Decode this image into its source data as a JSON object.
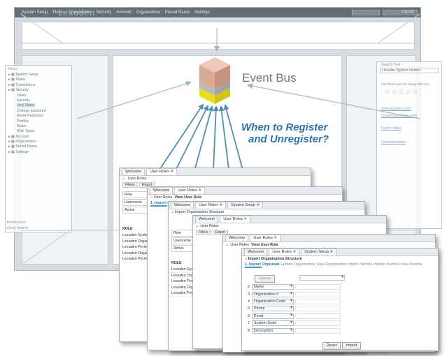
{
  "app": {
    "logo": "Lexaden",
    "menu": [
      "System Setup",
      "Flows",
      "Translations",
      "Security",
      "Account",
      "Organisation",
      "Period Name",
      "Settings"
    ],
    "logout": "Log out"
  },
  "nav": {
    "title": "Menu",
    "items": [
      {
        "label": "System Setup",
        "level": 0
      },
      {
        "label": "Flows",
        "level": 0
      },
      {
        "label": "Translations",
        "level": 0
      },
      {
        "label": "Security",
        "level": 0
      },
      {
        "label": "Users",
        "level": 1
      },
      {
        "label": "Security",
        "level": 1
      },
      {
        "label": "User Roles",
        "level": 1
      },
      {
        "label": "Change password",
        "level": 1
      },
      {
        "label": "Reset Password",
        "level": 1
      },
      {
        "label": "Profiles",
        "level": 1
      },
      {
        "label": "Roles",
        "level": 1
      },
      {
        "label": "Role Types",
        "level": 1
      },
      {
        "label": "Account",
        "level": 0
      },
      {
        "label": "Organisation",
        "level": 0
      },
      {
        "label": "Period Name",
        "level": 0
      },
      {
        "label": "Settings",
        "level": 0
      }
    ],
    "footer1": "Preferences",
    "footer2": "Quick Search"
  },
  "right_panel": {
    "title": "Search Text",
    "input": "Lexaden System monitor",
    "rating_text": "Get thank you for rating this tool",
    "links": [
      "www.lexaden.com",
      "contact@lexaden.com",
      "Demo Video",
      "Documentation"
    ]
  },
  "diagram": {
    "bus_label": "Event Bus",
    "question_line1": "When to Register",
    "question_line2": "and Unregister?"
  },
  "windows": {
    "tabs": {
      "welcome": "Welcome",
      "user_roles": "User Roles",
      "system_setup": "System Setup",
      "close": "✕"
    },
    "user_roles_title": "User Roles",
    "view_user_role": "View User Role",
    "filters": "Filters",
    "export": "Export",
    "fields": [
      "Role",
      "Username",
      "Active"
    ],
    "role_section": "ROLE",
    "role_list": [
      "Lexaden System",
      "Lexaden Organisation",
      "Lexaden Periods",
      "Lexaden Organisation",
      "Lexaden Periods"
    ],
    "import_title": "Import Organisation Structure",
    "steps": [
      "1. Import Organisat",
      "Update Organisation",
      "View Organisation",
      "Import Periods",
      "Update Periods",
      "View Periods"
    ],
    "upload": "Upload",
    "grid_rows": [
      {
        "n": "2",
        "label": "Name"
      },
      {
        "n": "3",
        "label": "Organisation #"
      },
      {
        "n": "4",
        "label": "Organisation Code"
      },
      {
        "n": "5",
        "label": "Phone"
      },
      {
        "n": "6",
        "label": "Email"
      },
      {
        "n": "7",
        "label": "System Code"
      },
      {
        "n": "8",
        "label": "Description"
      }
    ],
    "reset": "Reset",
    "import": "Import"
  }
}
